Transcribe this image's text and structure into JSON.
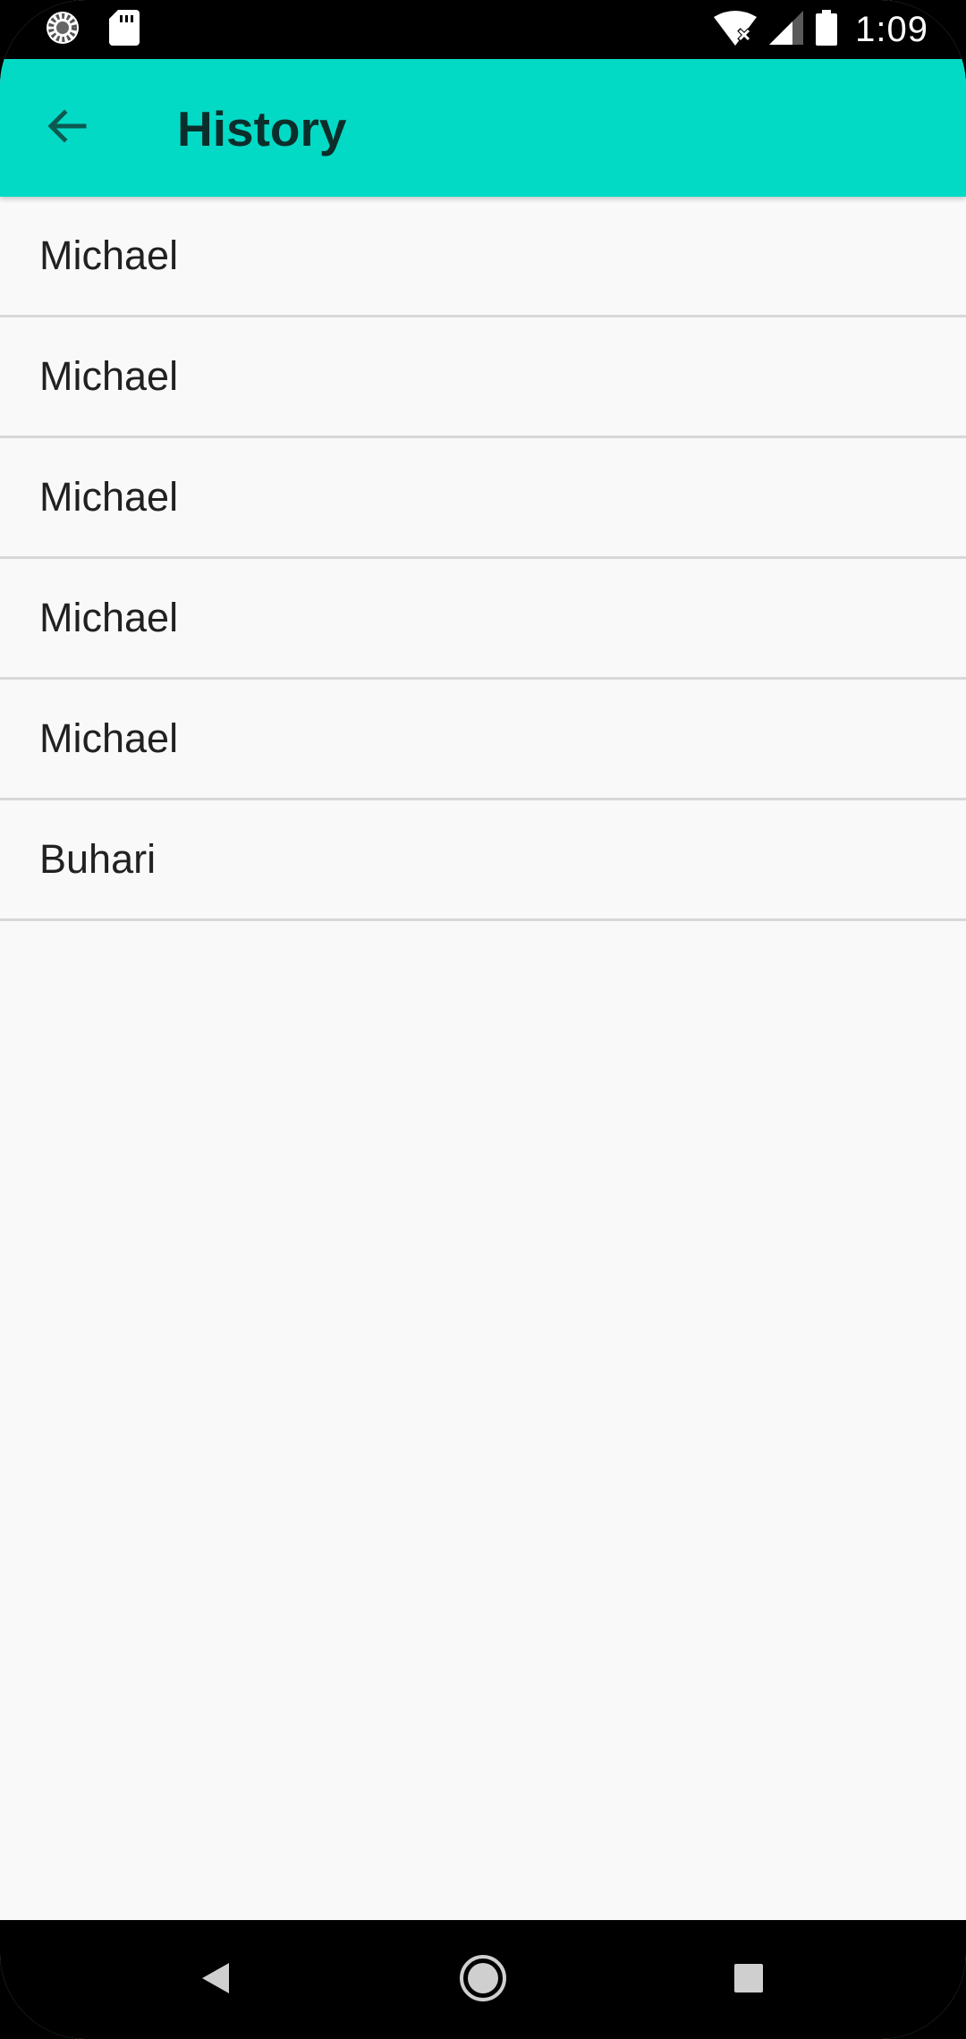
{
  "status_bar": {
    "time": "1:09",
    "icons": [
      "loading-circle-icon",
      "sd-card-icon",
      "wifi-off-icon",
      "cellular-signal-icon",
      "battery-icon"
    ]
  },
  "app_bar": {
    "title": "History",
    "back_icon": "arrow-back-icon",
    "background_color": "#03dac6"
  },
  "history": {
    "items": [
      {
        "name": "Michael"
      },
      {
        "name": "Michael"
      },
      {
        "name": "Michael"
      },
      {
        "name": "Michael"
      },
      {
        "name": "Michael"
      },
      {
        "name": "Buhari"
      }
    ]
  },
  "nav_bar": {
    "buttons": [
      "back-triangle-icon",
      "home-circle-icon",
      "recents-square-icon"
    ]
  }
}
